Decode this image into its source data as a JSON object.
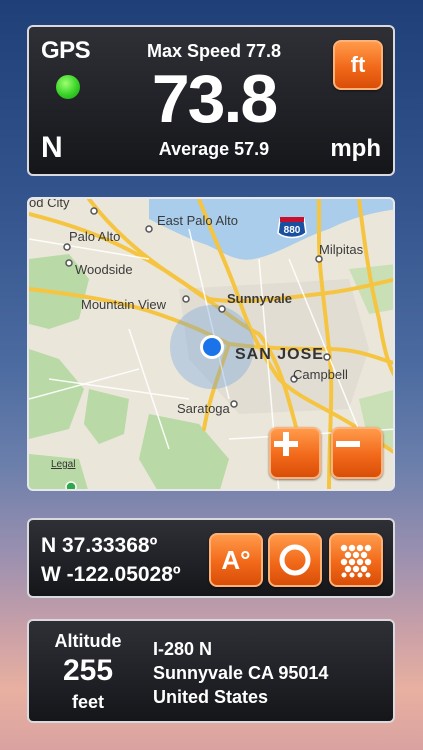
{
  "speed_panel": {
    "gps_label": "GPS",
    "heading": "N",
    "max_speed": "Max Speed 77.8",
    "current_speed": "73.8",
    "average_speed": "Average 57.9",
    "unit": "mph",
    "unit_toggle_label": "ft"
  },
  "map": {
    "places": {
      "top_city": "od City",
      "east_palo_alto": "East Palo Alto",
      "palo_alto": "Palo Alto",
      "milpitas": "Milpitas",
      "woodside": "Woodside",
      "mountain_view": "Mountain View",
      "sunnyvale": "Sunnyvale",
      "san_jose": "SAN JOSE",
      "campbell": "Campbell",
      "saratoga": "Saratoga",
      "highway_880": "880"
    },
    "legal": "Legal",
    "zoom_in": "+",
    "zoom_out": "−"
  },
  "coords": {
    "latitude": "N 37.33368º",
    "longitude": "W -122.05028º",
    "altitude_mode_label": "A°"
  },
  "address": {
    "altitude_label": "Altitude",
    "altitude_value": "255",
    "altitude_unit": "feet",
    "line1": "I-280 N",
    "line2": "Sunnyvale CA 95014",
    "line3": "United States"
  },
  "colors": {
    "accent_orange": "#f2691a",
    "gps_green": "#37d226",
    "location_blue": "#1a73e8"
  }
}
